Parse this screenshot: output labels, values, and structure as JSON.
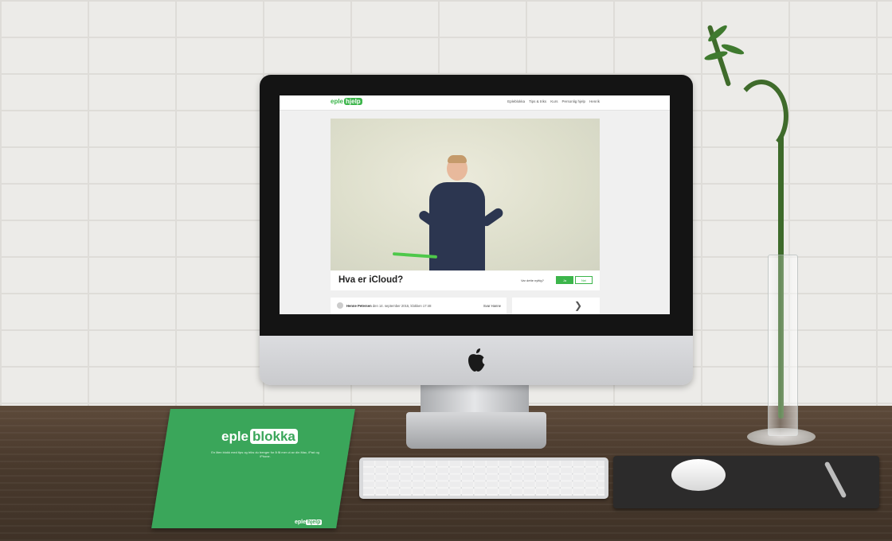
{
  "site": {
    "logo_word": "eple",
    "logo_pill": "hjelp",
    "nav": [
      "Epleblokka",
      "Tips & triks",
      "Kurs",
      "Personlig hjelp",
      "Henrik"
    ]
  },
  "article": {
    "title": "Hva er iCloud?",
    "useful_question": "Var dette nyttig?",
    "yes_label": "Ja",
    "no_label": "Nei"
  },
  "comment": {
    "author": "Henne Petersen",
    "date": "den 14. september 2015, klokken 17:48",
    "reply_label": "Svar Hanne"
  },
  "next_icon": "chevron-right-icon",
  "brochure": {
    "title_word": "eple",
    "title_pill": "blokka",
    "text": "En liten blokk med tips og triks du trenger for å få mer ut av din Mac, iPad og iPhone.",
    "footer_word": "eple",
    "footer_pill": "hjelp"
  },
  "colors": {
    "brand_green": "#3cb54b",
    "brochure_green": "#3aa65a"
  }
}
